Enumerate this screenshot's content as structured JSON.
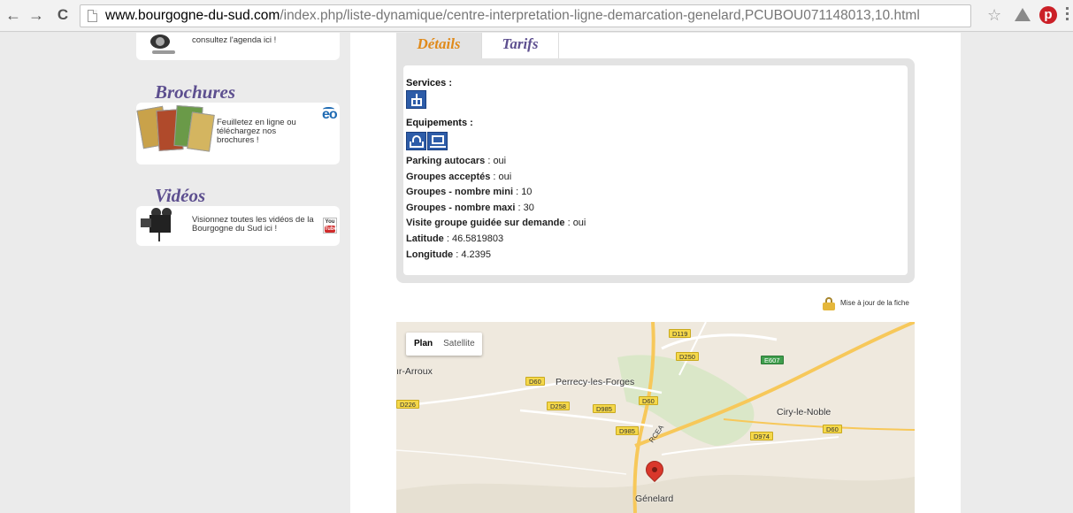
{
  "browser": {
    "url_domain": "www.bourgogne-du-sud.com",
    "url_path": "/index.php/liste-dynamique/centre-interpretation-ligne-demarcation-genelard,PCUBOU071148013,10.html",
    "back_glyph": "←",
    "forward_glyph": "→",
    "reload_glyph": "C",
    "bookmark_glyph": "☆",
    "extension_pinterest_glyph": "p"
  },
  "sidebar": {
    "agenda_text": "consultez l'agenda ici !",
    "brochures_title": "Brochures",
    "brochures_text": "Feuilletez en ligne ou téléchargez nos brochures !",
    "eo_logo": "eo",
    "videos_title": "Vidéos",
    "videos_text": "Visionnez toutes les vidéos de la Bourgogne du Sud ici !",
    "youtube_you": "You",
    "youtube_tube": "Tube"
  },
  "tabs": {
    "details": "Détails",
    "tarifs": "Tarifs"
  },
  "details": {
    "services_label": "Services :",
    "equipements_label": "Equipements :",
    "rows": [
      {
        "key": "Parking autocars",
        "value": "oui"
      },
      {
        "key": "Groupes acceptés",
        "value": "oui"
      },
      {
        "key": "Groupes - nombre mini",
        "value": "10"
      },
      {
        "key": "Groupes - nombre maxi",
        "value": "30"
      },
      {
        "key": "Visite groupe guidée sur demande",
        "value": "oui"
      },
      {
        "key": "Latitude",
        "value": "46.5819803"
      },
      {
        "key": "Longitude",
        "value": "4.2395"
      }
    ],
    "separator": " : "
  },
  "update_link": "Mise à jour de la fiche",
  "map": {
    "type_plan": "Plan",
    "type_satellite": "Satellite",
    "places": {
      "arroux": "ır-Arroux",
      "perrecy": "Perrecy-les-Forges",
      "ciry": "Ciry-le-Noble",
      "genelard": "Génelard"
    },
    "roads": {
      "d119": "D119",
      "d250": "D250",
      "e607": "E607",
      "d60a": "D60",
      "d60b": "D60",
      "d60c": "D60",
      "d226": "D226",
      "d258": "D258",
      "d985a": "D985",
      "d985b": "D985",
      "d974": "D974",
      "rcea": "RCEA"
    },
    "colors": {
      "land": "#efe9de",
      "forest": "#c9dfb4",
      "highway": "#f7c85a",
      "road": "#ffffff",
      "marker": "#d9372b"
    }
  }
}
